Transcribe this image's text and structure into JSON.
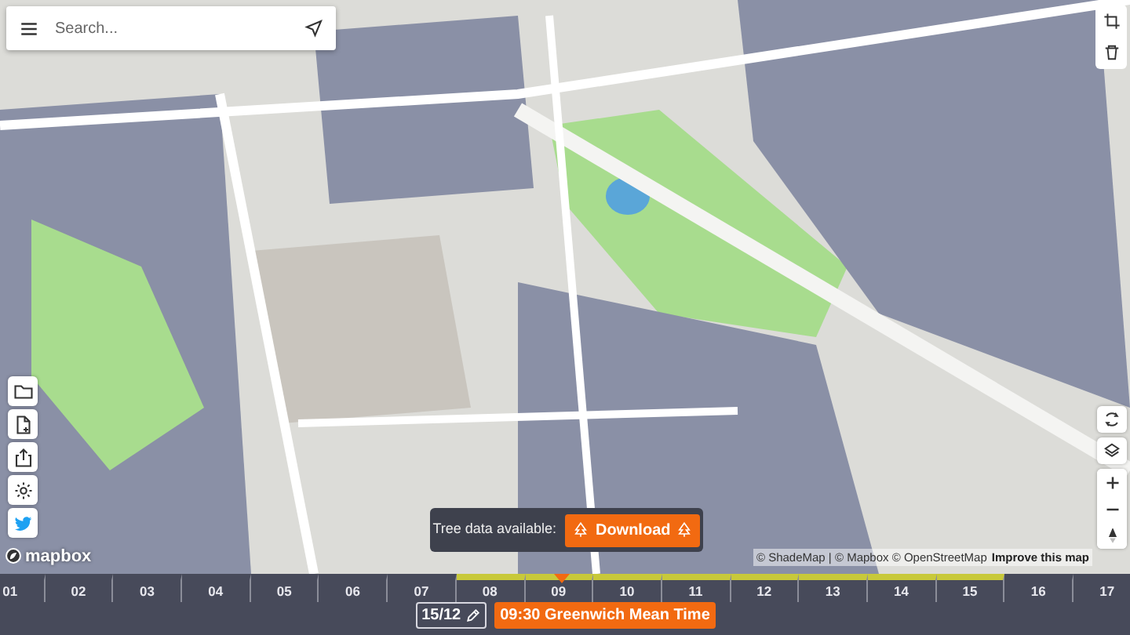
{
  "search": {
    "placeholder": "Search..."
  },
  "logo": "mapbox",
  "attribution": {
    "text": "© ShadeMap | © Mapbox © OpenStreetMap",
    "link": "Improve this map"
  },
  "tree_banner": {
    "label": "Tree data available:",
    "button": "Download"
  },
  "timeline": {
    "hours": [
      {
        "label": "01",
        "daylight": false
      },
      {
        "label": "02",
        "daylight": false
      },
      {
        "label": "03",
        "daylight": false
      },
      {
        "label": "04",
        "daylight": false
      },
      {
        "label": "05",
        "daylight": false
      },
      {
        "label": "06",
        "daylight": false
      },
      {
        "label": "07",
        "daylight": false
      },
      {
        "label": "08",
        "daylight": true
      },
      {
        "label": "09",
        "daylight": true
      },
      {
        "label": "10",
        "daylight": true
      },
      {
        "label": "11",
        "daylight": true
      },
      {
        "label": "12",
        "daylight": true
      },
      {
        "label": "13",
        "daylight": true
      },
      {
        "label": "14",
        "daylight": true
      },
      {
        "label": "15",
        "daylight": true
      },
      {
        "label": "16",
        "daylight": false
      },
      {
        "label": "17",
        "daylight": false
      }
    ],
    "marker": {
      "level": 0.497
    },
    "date": "15/12",
    "time": "09:30 Greenwich Mean Time"
  }
}
